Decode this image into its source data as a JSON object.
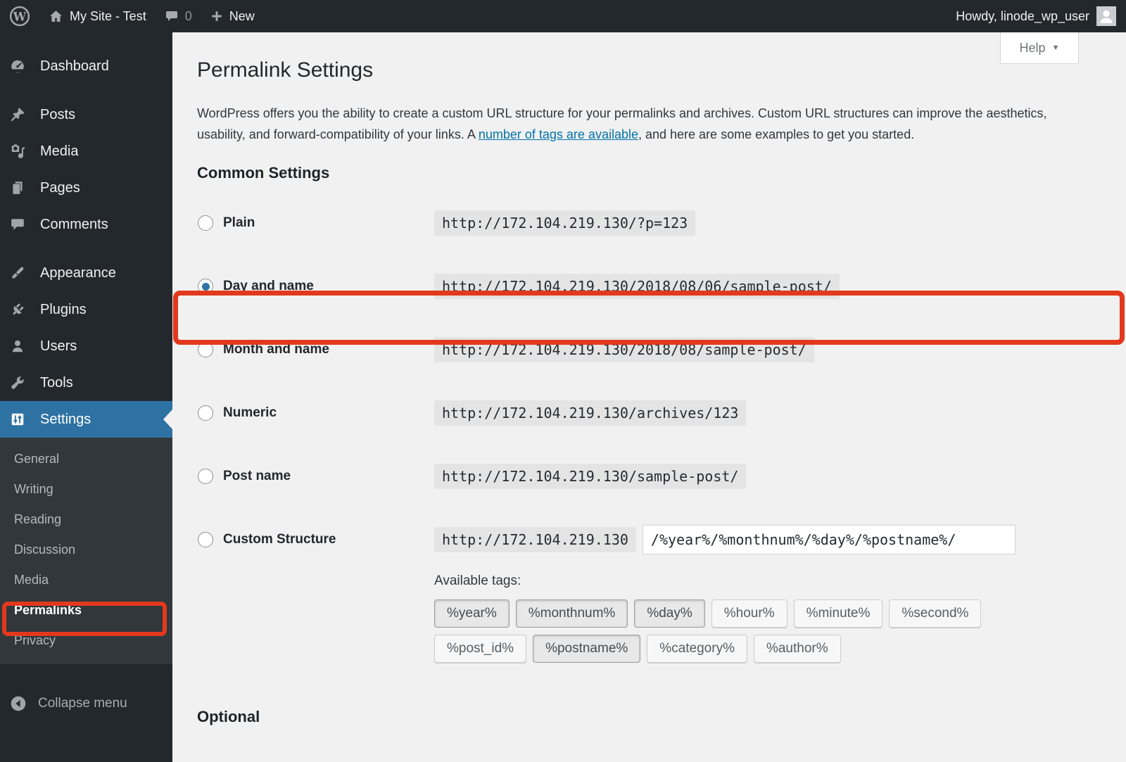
{
  "admin_bar": {
    "wp_logo": "W",
    "site_name": "My Site - Test",
    "comment_count": "0",
    "new_label": "New",
    "howdy": "Howdy, linode_wp_user"
  },
  "sidebar": {
    "items": [
      {
        "label": "Dashboard"
      },
      {
        "label": "Posts"
      },
      {
        "label": "Media"
      },
      {
        "label": "Pages"
      },
      {
        "label": "Comments"
      },
      {
        "label": "Appearance"
      },
      {
        "label": "Plugins"
      },
      {
        "label": "Users"
      },
      {
        "label": "Tools"
      },
      {
        "label": "Settings"
      }
    ],
    "settings_submenu": [
      "General",
      "Writing",
      "Reading",
      "Discussion",
      "Media",
      "Permalinks",
      "Privacy"
    ],
    "collapse_label": "Collapse menu"
  },
  "header": {
    "title": "Permalink Settings",
    "help_label": "Help"
  },
  "intro": {
    "before_link": "WordPress offers you the ability to create a custom URL structure for your permalinks and archives. Custom URL structures can improve the aesthetics, usability, and forward-compatibility of your links. A ",
    "link_text": "number of tags are available",
    "after_link": ", and here are some examples to get you started."
  },
  "common_settings": {
    "heading": "Common Settings",
    "rows": [
      {
        "label": "Plain",
        "value": "http://172.104.219.130/?p=123",
        "checked": false
      },
      {
        "label": "Day and name",
        "value": "http://172.104.219.130/2018/08/06/sample-post/",
        "checked": true
      },
      {
        "label": "Month and name",
        "value": "http://172.104.219.130/2018/08/sample-post/",
        "checked": false
      },
      {
        "label": "Numeric",
        "value": "http://172.104.219.130/archives/123",
        "checked": false
      },
      {
        "label": "Post name",
        "value": "http://172.104.219.130/sample-post/",
        "checked": false
      },
      {
        "label": "Custom Structure",
        "prefix": "http://172.104.219.130",
        "input_value": "/%year%/%monthnum%/%day%/%postname%/",
        "checked": false
      }
    ],
    "available_tags_label": "Available tags:",
    "tags": [
      {
        "label": "%year%",
        "used": true
      },
      {
        "label": "%monthnum%",
        "used": true
      },
      {
        "label": "%day%",
        "used": true
      },
      {
        "label": "%hour%",
        "used": false
      },
      {
        "label": "%minute%",
        "used": false
      },
      {
        "label": "%second%",
        "used": false
      },
      {
        "label": "%post_id%",
        "used": false
      },
      {
        "label": "%postname%",
        "used": true
      },
      {
        "label": "%category%",
        "used": false
      },
      {
        "label": "%author%",
        "used": false
      }
    ]
  },
  "optional_heading": "Optional",
  "colors": {
    "admin_bar_bg": "#23282d",
    "submenu_bg": "#32373c",
    "selected_menu_bg": "#2e72a4",
    "content_bg": "#f1f1f1",
    "link": "#0073aa",
    "annotation_red": "#e2391c",
    "radio_dot_blue": "#2f73a4"
  }
}
